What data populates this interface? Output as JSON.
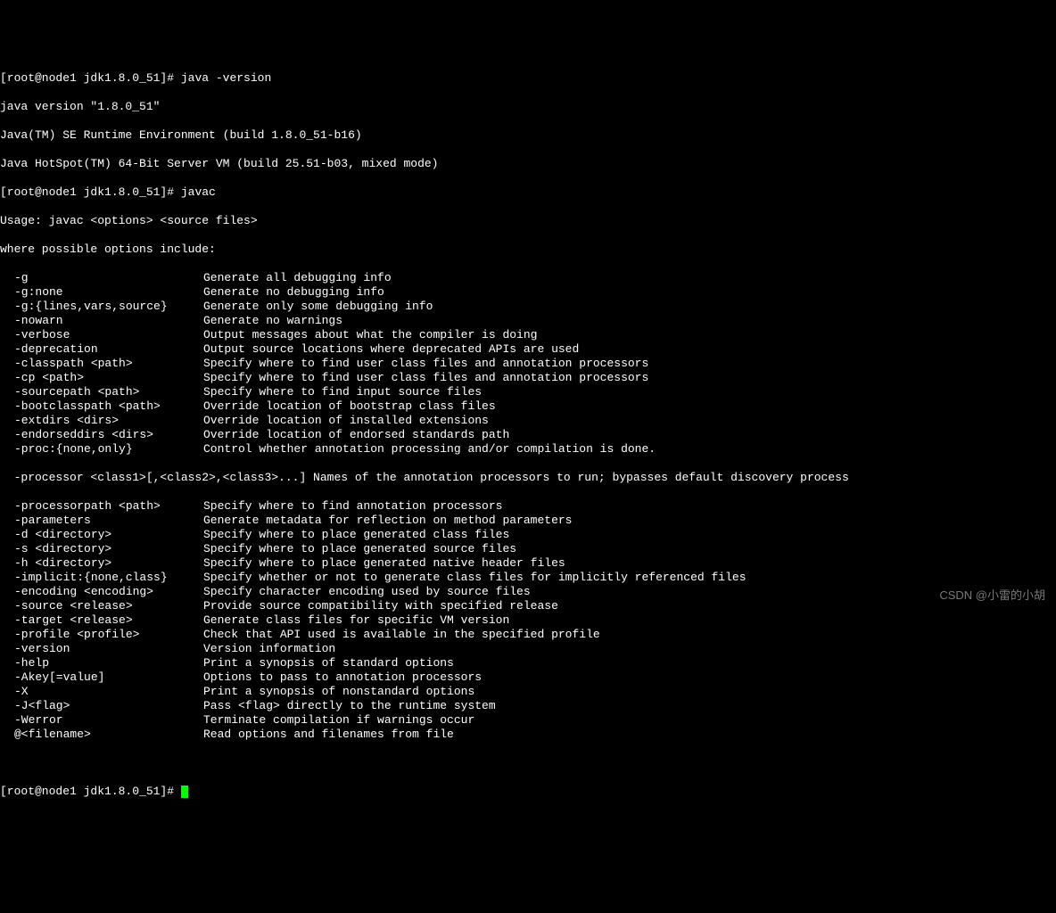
{
  "prompt1": "[root@node1 jdk1.8.0_51]# ",
  "cmd1": "java -version",
  "ver_line1": "java version \"1.8.0_51\"",
  "ver_line2": "Java(TM) SE Runtime Environment (build 1.8.0_51-b16)",
  "ver_line3": "Java HotSpot(TM) 64-Bit Server VM (build 25.51-b03, mixed mode)",
  "prompt2": "[root@node1 jdk1.8.0_51]# ",
  "cmd2": "javac",
  "usage_line": "Usage: javac <options> <source files>",
  "where_line": "where possible options include:",
  "options": [
    {
      "flag": "-g",
      "desc": "Generate all debugging info"
    },
    {
      "flag": "-g:none",
      "desc": "Generate no debugging info"
    },
    {
      "flag": "-g:{lines,vars,source}",
      "desc": "Generate only some debugging info"
    },
    {
      "flag": "-nowarn",
      "desc": "Generate no warnings"
    },
    {
      "flag": "-verbose",
      "desc": "Output messages about what the compiler is doing"
    },
    {
      "flag": "-deprecation",
      "desc": "Output source locations where deprecated APIs are used"
    },
    {
      "flag": "-classpath <path>",
      "desc": "Specify where to find user class files and annotation processors"
    },
    {
      "flag": "-cp <path>",
      "desc": "Specify where to find user class files and annotation processors"
    },
    {
      "flag": "-sourcepath <path>",
      "desc": "Specify where to find input source files"
    },
    {
      "flag": "-bootclasspath <path>",
      "desc": "Override location of bootstrap class files"
    },
    {
      "flag": "-extdirs <dirs>",
      "desc": "Override location of installed extensions"
    },
    {
      "flag": "-endorseddirs <dirs>",
      "desc": "Override location of endorsed standards path"
    },
    {
      "flag": "-proc:{none,only}",
      "desc": "Control whether annotation processing and/or compilation is done."
    }
  ],
  "processor_line": "  -processor <class1>[,<class2>,<class3>...] Names of the annotation processors to run; bypasses default discovery process",
  "options2": [
    {
      "flag": "-processorpath <path>",
      "desc": "Specify where to find annotation processors"
    },
    {
      "flag": "-parameters",
      "desc": "Generate metadata for reflection on method parameters"
    },
    {
      "flag": "-d <directory>",
      "desc": "Specify where to place generated class files"
    },
    {
      "flag": "-s <directory>",
      "desc": "Specify where to place generated source files"
    },
    {
      "flag": "-h <directory>",
      "desc": "Specify where to place generated native header files"
    },
    {
      "flag": "-implicit:{none,class}",
      "desc": "Specify whether or not to generate class files for implicitly referenced files"
    },
    {
      "flag": "-encoding <encoding>",
      "desc": "Specify character encoding used by source files"
    },
    {
      "flag": "-source <release>",
      "desc": "Provide source compatibility with specified release"
    },
    {
      "flag": "-target <release>",
      "desc": "Generate class files for specific VM version"
    },
    {
      "flag": "-profile <profile>",
      "desc": "Check that API used is available in the specified profile"
    },
    {
      "flag": "-version",
      "desc": "Version information"
    },
    {
      "flag": "-help",
      "desc": "Print a synopsis of standard options"
    },
    {
      "flag": "-Akey[=value]",
      "desc": "Options to pass to annotation processors"
    },
    {
      "flag": "-X",
      "desc": "Print a synopsis of nonstandard options"
    },
    {
      "flag": "-J<flag>",
      "desc": "Pass <flag> directly to the runtime system"
    },
    {
      "flag": "-Werror",
      "desc": "Terminate compilation if warnings occur"
    },
    {
      "flag": "@<filename>",
      "desc": "Read options and filenames from file"
    }
  ],
  "prompt3": "[root@node1 jdk1.8.0_51]# ",
  "watermark": "CSDN @小雷的小胡"
}
